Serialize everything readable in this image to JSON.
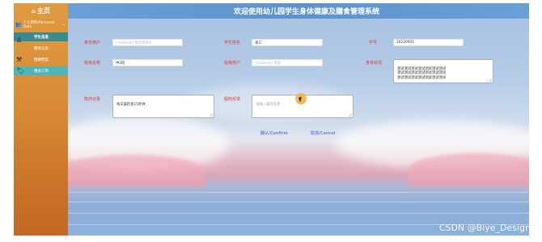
{
  "header": {
    "title": "欢迎使用幼儿园学生身体健康及膳食管理系统"
  },
  "sidebar": {
    "home_label": "主页",
    "home_icon": "home-icon",
    "group_label": "个人资料/Personal Data",
    "items": [
      {
        "label": "学生信息",
        "icon": "user-icon"
      },
      {
        "label": "膳食信息",
        "icon": "tools-icon"
      },
      {
        "label": "健康档案",
        "icon": "document-icon"
      },
      {
        "label": "膳食订单",
        "icon": "tag-icon"
      }
    ]
  },
  "form": {
    "parent_user": {
      "label": "家长用户",
      "placeholder": "[readonly] 请选择家长"
    },
    "student_name": {
      "label": "学生姓名",
      "value": "张三"
    },
    "student_id": {
      "label": "学号",
      "value": "20220001"
    },
    "class_name": {
      "label": "班级名称",
      "value": "中2班"
    },
    "teacher_user": {
      "label": "班级用户",
      "placeholder": "[readonly] 班级"
    },
    "health_status": {
      "label": "身体状况",
      "value": "测试测试测试测试测试测试测试\n测试测试测试测试测试测试测试\n测试测试测试测试测试测试测试"
    },
    "medication_record": {
      "label": "既药记录",
      "value": "每天晨检查15秒钟"
    },
    "medication_reply": {
      "label": "服药反馈",
      "placeholder": "请输入服药反馈"
    },
    "confirm_label": "确认/Confirm",
    "cancel_label": "取消/Cancel"
  },
  "watermark": "CSDN @Biye_Design",
  "colors": {
    "sidebar": "#d98c36",
    "header": "#5c93cf",
    "label": "#e03a2a",
    "button": "#6a8fd8",
    "active_item": "#3a8b8f"
  }
}
